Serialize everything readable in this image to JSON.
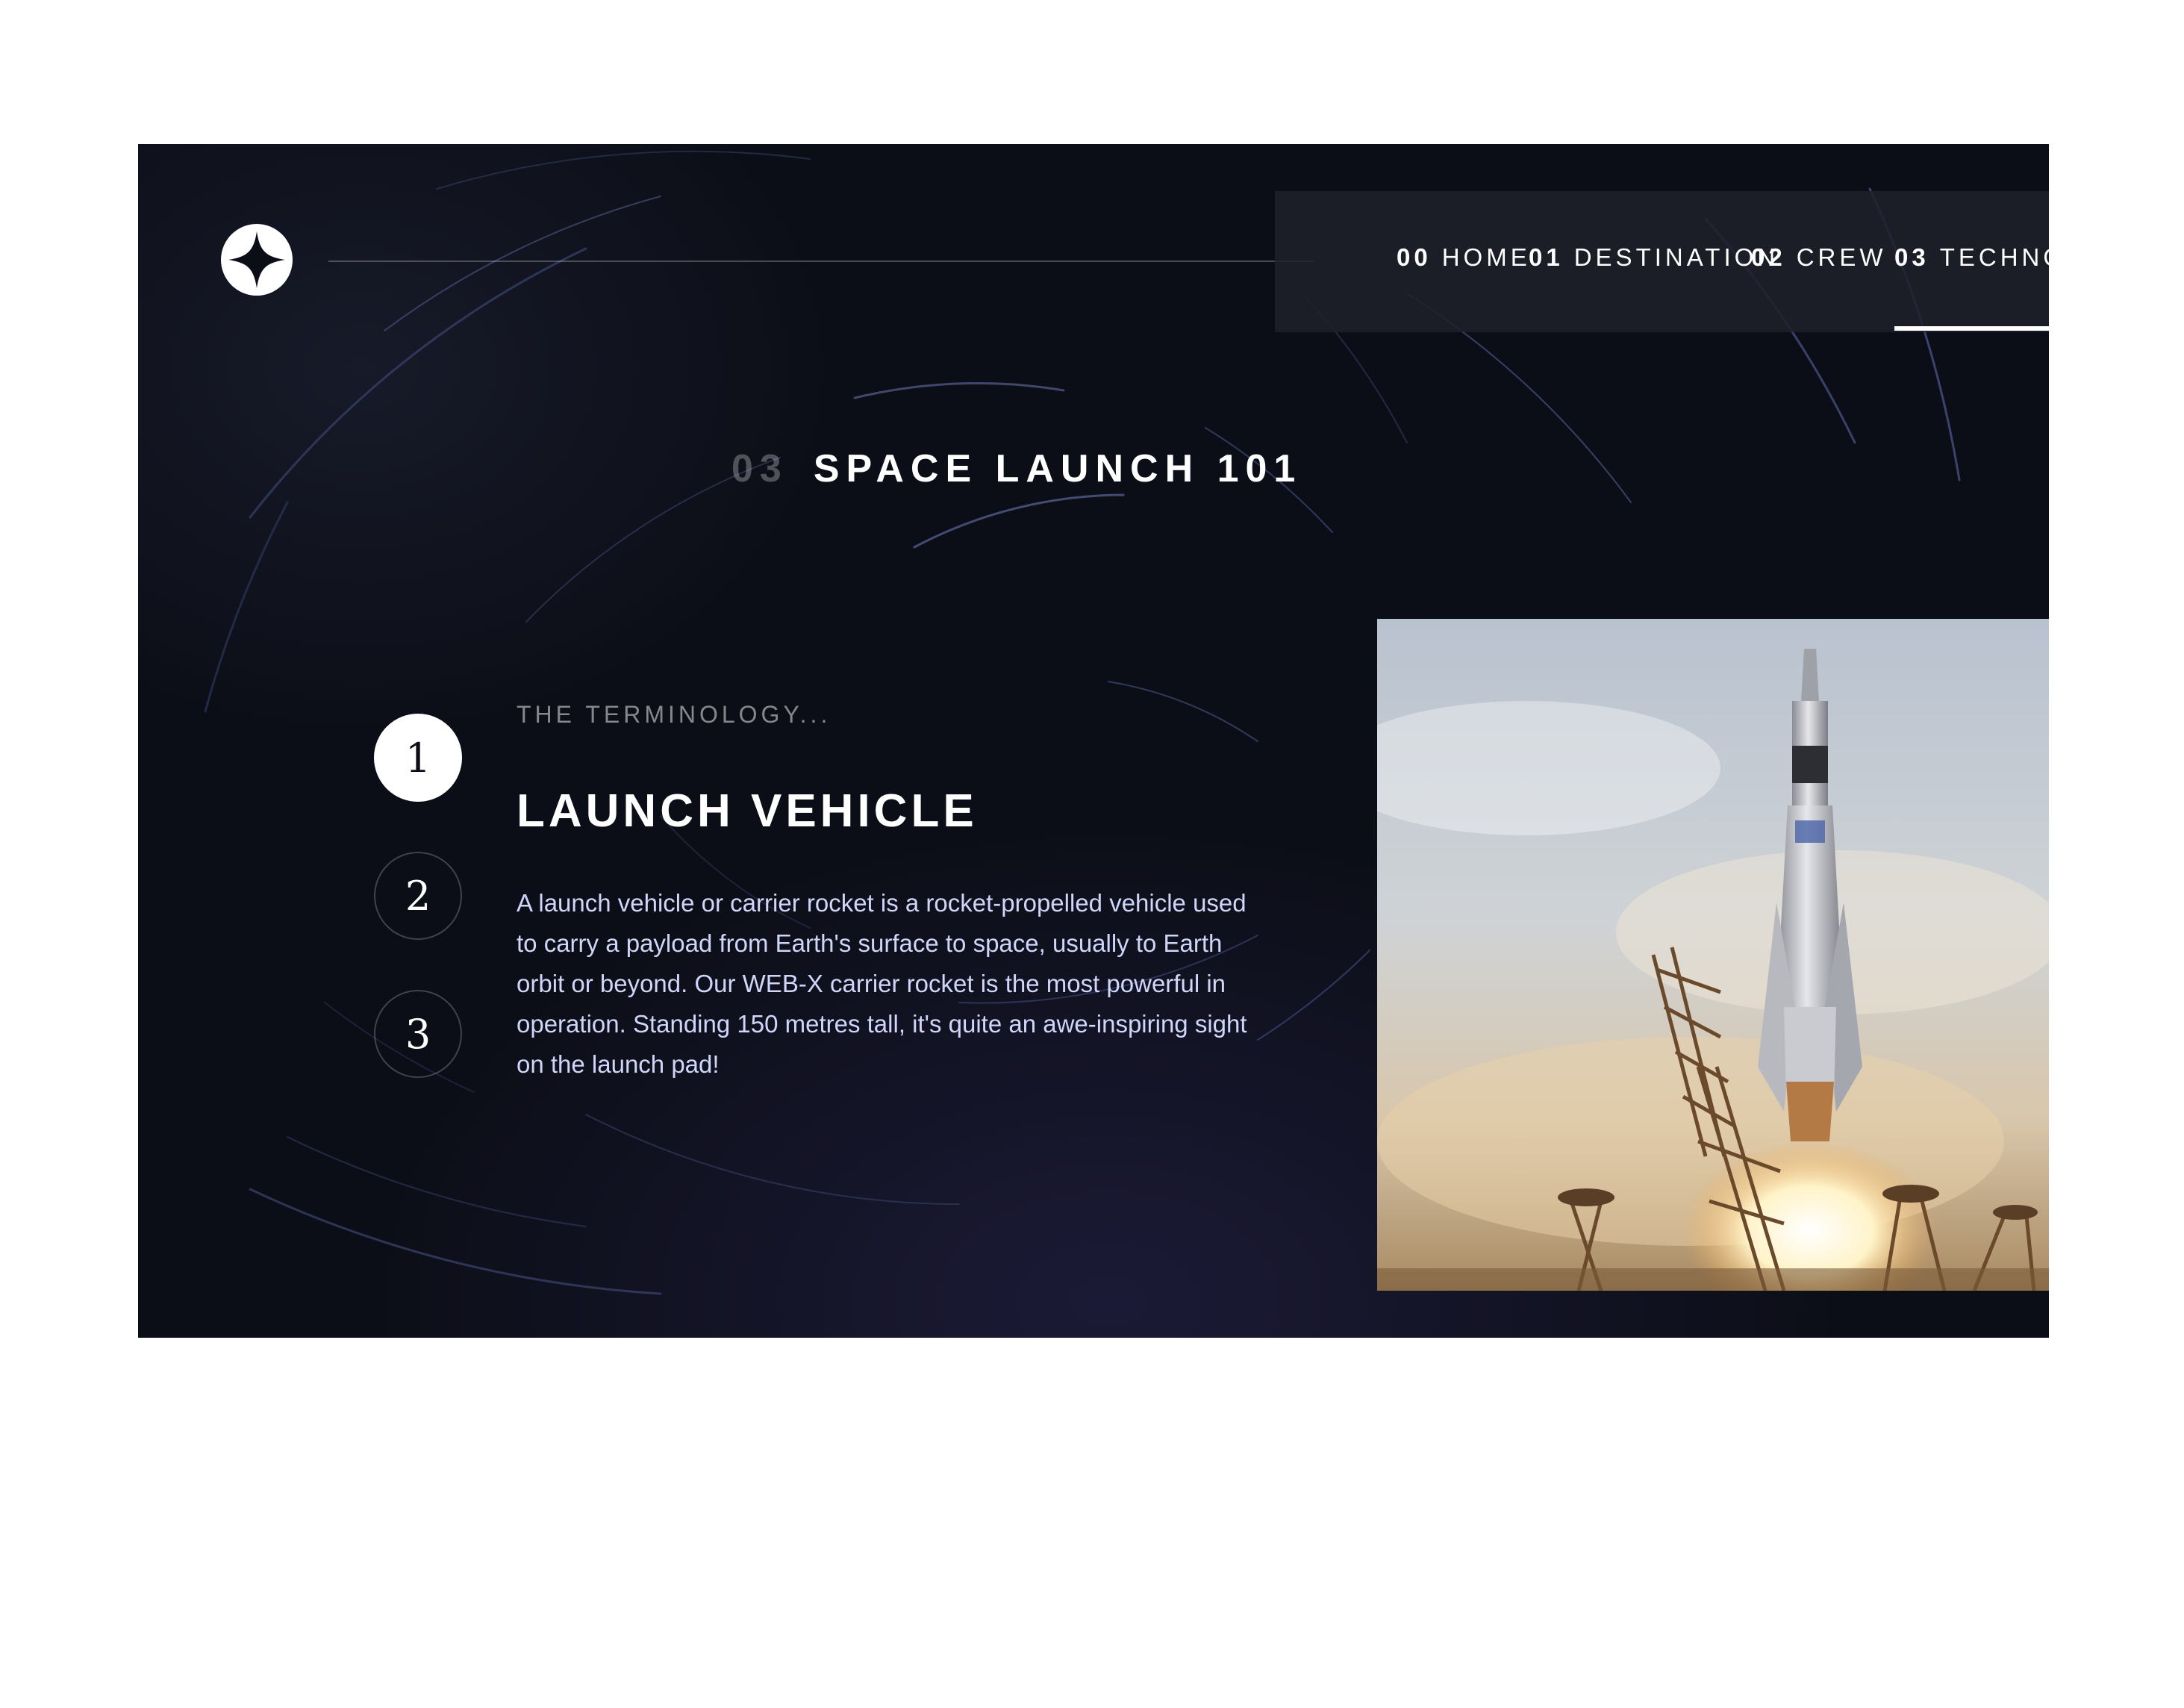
{
  "nav": {
    "items": [
      {
        "num": "00",
        "label": "HOME"
      },
      {
        "num": "01",
        "label": "DESTINATION"
      },
      {
        "num": "02",
        "label": "CREW"
      },
      {
        "num": "03",
        "label": "TECHNOL"
      }
    ],
    "active_index": 3
  },
  "heading": {
    "num": "03",
    "text": "SPACE LAUNCH 101"
  },
  "steps": [
    "1",
    "2",
    "3"
  ],
  "active_step": 0,
  "content": {
    "eyebrow": "THE TERMINOLOGY...",
    "title": "LAUNCH VEHICLE",
    "description": "A launch vehicle or carrier rocket is a rocket-propelled vehicle used to carry a payload from Earth's surface to space, usually to Earth orbit or beyond. Our WEB-X carrier rocket is the most powerful in operation. Standing 150 metres tall, it's quite an awe-inspiring sight on the launch pad!"
  },
  "icons": {
    "logo": "four-point-star-icon"
  },
  "colors": {
    "background": "#0c0e17",
    "text": "#ffffff",
    "body_text": "#d0d6f9",
    "nav_bg": "#1e202a"
  }
}
